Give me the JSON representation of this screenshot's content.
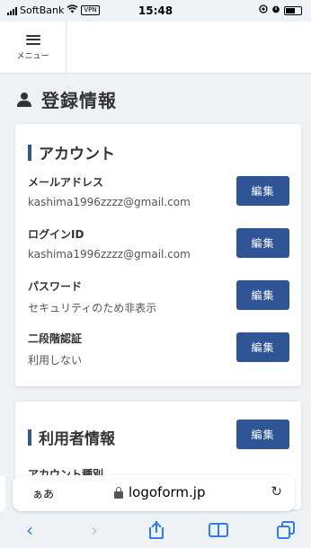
{
  "status_bar": {
    "carrier": "SoftBank",
    "vpn": "VPN",
    "time": "15:48"
  },
  "header": {
    "menu_label": "メニュー"
  },
  "page": {
    "title": "登録情報"
  },
  "account_section": {
    "title": "アカウント",
    "fields": [
      {
        "label": "メールアドレス",
        "value": "kashima1996zzzz@gmail.com",
        "button": "編集"
      },
      {
        "label": "ログインID",
        "value": "kashima1996zzzz@gmail.com",
        "button": "編集"
      },
      {
        "label": "パスワード",
        "value": "セキュリティのため非表示",
        "button": "編集"
      },
      {
        "label": "二段階認証",
        "value": "利用しない",
        "button": "編集"
      }
    ]
  },
  "user_section": {
    "title": "利用者情報",
    "button": "編集",
    "partial_label": "アカウント種別"
  },
  "browser": {
    "aa_label": "ぁあ",
    "url": "logoform.jp",
    "reload_glyph": "↻",
    "back_glyph": "‹",
    "forward_glyph": "›"
  },
  "colors": {
    "accent": "#2f5597",
    "safari_blue": "#2f7bf6",
    "background": "#eef2f5"
  }
}
